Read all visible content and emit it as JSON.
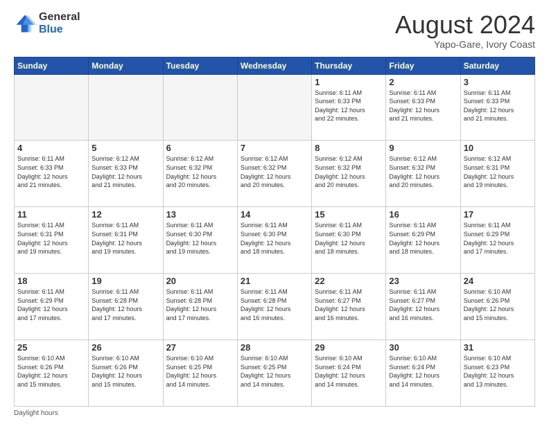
{
  "logo": {
    "general": "General",
    "blue": "Blue"
  },
  "header": {
    "month_year": "August 2024",
    "location": "Yapo-Gare, Ivory Coast"
  },
  "weekdays": [
    "Sunday",
    "Monday",
    "Tuesday",
    "Wednesday",
    "Thursday",
    "Friday",
    "Saturday"
  ],
  "footer": "Daylight hours",
  "weeks": [
    [
      {
        "day": "",
        "info": ""
      },
      {
        "day": "",
        "info": ""
      },
      {
        "day": "",
        "info": ""
      },
      {
        "day": "",
        "info": ""
      },
      {
        "day": "1",
        "info": "Sunrise: 6:11 AM\nSunset: 6:33 PM\nDaylight: 12 hours\nand 22 minutes."
      },
      {
        "day": "2",
        "info": "Sunrise: 6:11 AM\nSunset: 6:33 PM\nDaylight: 12 hours\nand 21 minutes."
      },
      {
        "day": "3",
        "info": "Sunrise: 6:11 AM\nSunset: 6:33 PM\nDaylight: 12 hours\nand 21 minutes."
      }
    ],
    [
      {
        "day": "4",
        "info": "Sunrise: 6:11 AM\nSunset: 6:33 PM\nDaylight: 12 hours\nand 21 minutes."
      },
      {
        "day": "5",
        "info": "Sunrise: 6:12 AM\nSunset: 6:33 PM\nDaylight: 12 hours\nand 21 minutes."
      },
      {
        "day": "6",
        "info": "Sunrise: 6:12 AM\nSunset: 6:32 PM\nDaylight: 12 hours\nand 20 minutes."
      },
      {
        "day": "7",
        "info": "Sunrise: 6:12 AM\nSunset: 6:32 PM\nDaylight: 12 hours\nand 20 minutes."
      },
      {
        "day": "8",
        "info": "Sunrise: 6:12 AM\nSunset: 6:32 PM\nDaylight: 12 hours\nand 20 minutes."
      },
      {
        "day": "9",
        "info": "Sunrise: 6:12 AM\nSunset: 6:32 PM\nDaylight: 12 hours\nand 20 minutes."
      },
      {
        "day": "10",
        "info": "Sunrise: 6:12 AM\nSunset: 6:31 PM\nDaylight: 12 hours\nand 19 minutes."
      }
    ],
    [
      {
        "day": "11",
        "info": "Sunrise: 6:11 AM\nSunset: 6:31 PM\nDaylight: 12 hours\nand 19 minutes."
      },
      {
        "day": "12",
        "info": "Sunrise: 6:11 AM\nSunset: 6:31 PM\nDaylight: 12 hours\nand 19 minutes."
      },
      {
        "day": "13",
        "info": "Sunrise: 6:11 AM\nSunset: 6:30 PM\nDaylight: 12 hours\nand 19 minutes."
      },
      {
        "day": "14",
        "info": "Sunrise: 6:11 AM\nSunset: 6:30 PM\nDaylight: 12 hours\nand 18 minutes."
      },
      {
        "day": "15",
        "info": "Sunrise: 6:11 AM\nSunset: 6:30 PM\nDaylight: 12 hours\nand 18 minutes."
      },
      {
        "day": "16",
        "info": "Sunrise: 6:11 AM\nSunset: 6:29 PM\nDaylight: 12 hours\nand 18 minutes."
      },
      {
        "day": "17",
        "info": "Sunrise: 6:11 AM\nSunset: 6:29 PM\nDaylight: 12 hours\nand 17 minutes."
      }
    ],
    [
      {
        "day": "18",
        "info": "Sunrise: 6:11 AM\nSunset: 6:29 PM\nDaylight: 12 hours\nand 17 minutes."
      },
      {
        "day": "19",
        "info": "Sunrise: 6:11 AM\nSunset: 6:28 PM\nDaylight: 12 hours\nand 17 minutes."
      },
      {
        "day": "20",
        "info": "Sunrise: 6:11 AM\nSunset: 6:28 PM\nDaylight: 12 hours\nand 17 minutes."
      },
      {
        "day": "21",
        "info": "Sunrise: 6:11 AM\nSunset: 6:28 PM\nDaylight: 12 hours\nand 16 minutes."
      },
      {
        "day": "22",
        "info": "Sunrise: 6:11 AM\nSunset: 6:27 PM\nDaylight: 12 hours\nand 16 minutes."
      },
      {
        "day": "23",
        "info": "Sunrise: 6:11 AM\nSunset: 6:27 PM\nDaylight: 12 hours\nand 16 minutes."
      },
      {
        "day": "24",
        "info": "Sunrise: 6:10 AM\nSunset: 6:26 PM\nDaylight: 12 hours\nand 15 minutes."
      }
    ],
    [
      {
        "day": "25",
        "info": "Sunrise: 6:10 AM\nSunset: 6:26 PM\nDaylight: 12 hours\nand 15 minutes."
      },
      {
        "day": "26",
        "info": "Sunrise: 6:10 AM\nSunset: 6:26 PM\nDaylight: 12 hours\nand 15 minutes."
      },
      {
        "day": "27",
        "info": "Sunrise: 6:10 AM\nSunset: 6:25 PM\nDaylight: 12 hours\nand 14 minutes."
      },
      {
        "day": "28",
        "info": "Sunrise: 6:10 AM\nSunset: 6:25 PM\nDaylight: 12 hours\nand 14 minutes."
      },
      {
        "day": "29",
        "info": "Sunrise: 6:10 AM\nSunset: 6:24 PM\nDaylight: 12 hours\nand 14 minutes."
      },
      {
        "day": "30",
        "info": "Sunrise: 6:10 AM\nSunset: 6:24 PM\nDaylight: 12 hours\nand 14 minutes."
      },
      {
        "day": "31",
        "info": "Sunrise: 6:10 AM\nSunset: 6:23 PM\nDaylight: 12 hours\nand 13 minutes."
      }
    ]
  ]
}
